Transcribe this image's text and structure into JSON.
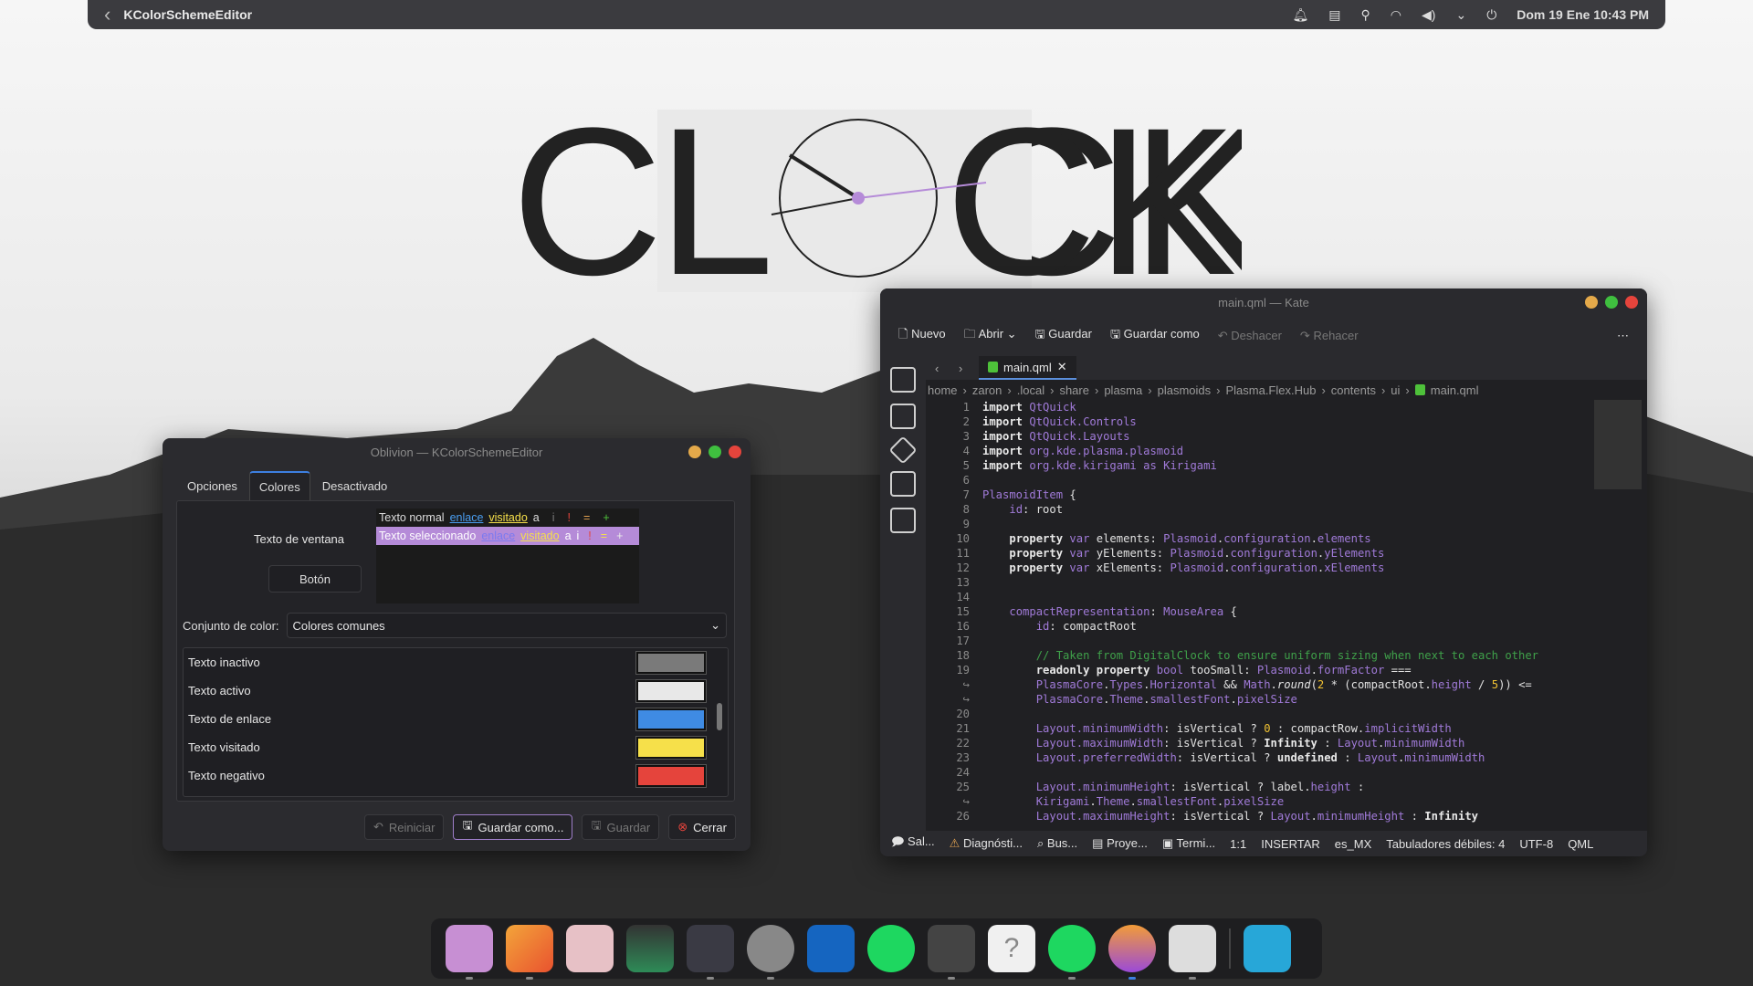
{
  "topbar": {
    "app_title": "KColorSchemeEditor",
    "datetime": "Dom 19 Ene 10:43 PM",
    "icons": [
      "notifications-icon",
      "clipboard-icon",
      "location-icon",
      "wifi-icon",
      "volume-icon",
      "chevron-down-icon",
      "power-icon"
    ]
  },
  "wallpaper": {
    "logo_text": "CLOCK"
  },
  "kcs": {
    "title": "Oblivion — KColorSchemeEditor",
    "tabs": [
      "Opciones",
      "Colores",
      "Desactivado"
    ],
    "active_tab": "Colores",
    "preview": {
      "label": "Texto de ventana",
      "row1": {
        "normal": "Texto normal",
        "link": "enlace",
        "visited": "visitado",
        "a": "a",
        "i": "i",
        "excl": "!",
        "eq": "=",
        "plus": "+"
      },
      "row2": {
        "normal": "Texto seleccionado",
        "link": "enlace",
        "visited": "visitado",
        "a": "a",
        "i": "i",
        "excl": "!",
        "eq": "=",
        "plus": "+"
      },
      "button": "Botón"
    },
    "color_set_label": "Conjunto de color:",
    "color_set_value": "Colores comunes",
    "colors": [
      {
        "label": "Texto inactivo",
        "color": "#7a7a7a"
      },
      {
        "label": "Texto activo",
        "color": "#e8e8e8"
      },
      {
        "label": "Texto de enlace",
        "color": "#3f8be3"
      },
      {
        "label": "Texto visitado",
        "color": "#f6e04a"
      },
      {
        "label": "Texto negativo",
        "color": "#e5443c"
      }
    ],
    "buttons": {
      "reset": "Reiniciar",
      "save_as": "Guardar como...",
      "save": "Guardar",
      "close": "Cerrar"
    }
  },
  "kate": {
    "title": "main.qml — Kate",
    "toolbar": {
      "new": "Nuevo",
      "open": "Abrir",
      "save": "Guardar",
      "save_as": "Guardar como",
      "undo": "Deshacer",
      "redo": "Rehacer"
    },
    "tab": "main.qml",
    "breadcrumb": [
      "home",
      "zaron",
      ".local",
      "share",
      "plasma",
      "plasmoids",
      "Plasma.Flex.Hub",
      "contents",
      "ui",
      "main.qml"
    ],
    "line_numbers": [
      "1",
      "2",
      "3",
      "4",
      "5",
      "6",
      "7",
      "8",
      "9",
      "10",
      "11",
      "12",
      "13",
      "14",
      "15",
      "16",
      "17",
      "18",
      "19",
      "↪",
      "↪",
      "20",
      "21",
      "22",
      "23",
      "24",
      "25",
      "↪",
      "26"
    ],
    "status": {
      "output": "Sal...",
      "diag": "Diagnósti...",
      "search": "Bus...",
      "project": "Proye...",
      "terminal": "Termi...",
      "pos": "1:1",
      "mode": "INSERTAR",
      "lang": "es_MX",
      "tabs": "Tabuladores débiles: 4",
      "enc": "UTF-8",
      "syntax": "QML"
    }
  },
  "dock": {
    "apps": [
      "files-icon",
      "gitkraken-icon",
      "store-icon",
      "image-viewer-icon",
      "terminal-icon",
      "settings-icon",
      "outlook-icon",
      "spotify-icon",
      "inkscape-icon",
      "help-icon",
      "spotify-icon",
      "firefox-icon",
      "notes-icon",
      "calculator-icon"
    ]
  }
}
